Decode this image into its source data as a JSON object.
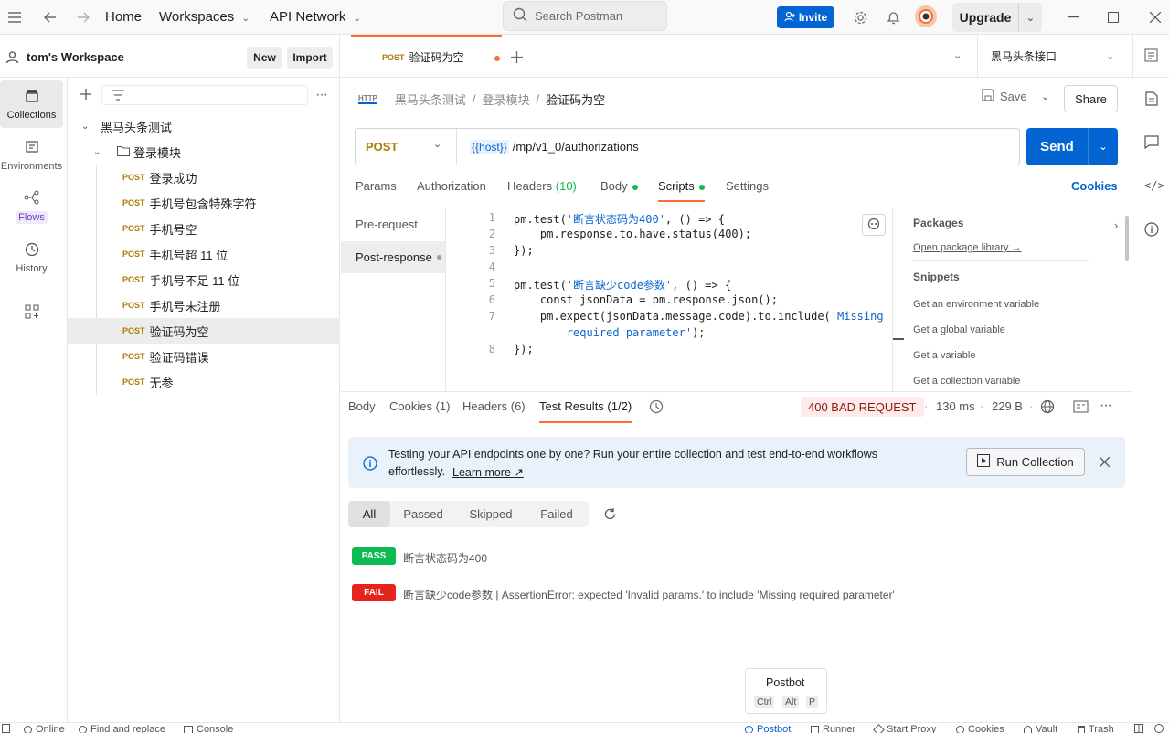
{
  "topbar": {
    "home": "Home",
    "workspaces": "Workspaces",
    "api_network": "API Network",
    "search_placeholder": "Search Postman",
    "invite": "Invite",
    "upgrade": "Upgrade"
  },
  "workspace": {
    "name": "tom's Workspace",
    "new": "New",
    "import": "Import"
  },
  "rail": [
    {
      "label": "Collections",
      "icon": "collections-icon"
    },
    {
      "label": "Environments",
      "icon": "environments-icon"
    },
    {
      "label": "Flows",
      "icon": "flows-icon"
    },
    {
      "label": "History",
      "icon": "history-icon"
    }
  ],
  "tree": {
    "collection": "黑马头条测试",
    "folder": "登录模块",
    "method": "POST",
    "requests": [
      "登录成功",
      "手机号包含特殊字符",
      "手机号空",
      "手机号超 11 位",
      "手机号不足 11 位",
      "手机号未注册",
      "验证码为空",
      "验证码错误",
      "无参"
    ]
  },
  "tab": {
    "method": "POST",
    "title": "验证码为空",
    "environment": "黑马头条接口"
  },
  "breadcrumb": {
    "collection": "黑马头条测试",
    "sep1": "/",
    "folder": "登录模块",
    "sep2": "/",
    "request": "验证码为空",
    "save": "Save",
    "share": "Share"
  },
  "request": {
    "method": "POST",
    "url_var": "{{host}}",
    "url_path": "/mp/v1_0/authorizations",
    "send": "Send",
    "tabs": {
      "params": "Params",
      "authorization": "Authorization",
      "headers": "Headers",
      "headers_count": "(10)",
      "body": "Body",
      "scripts": "Scripts",
      "settings": "Settings",
      "cookies": "Cookies"
    },
    "script_tabs": [
      "Pre-request",
      "Post-response"
    ]
  },
  "code_lines": [
    {
      "n": "1",
      "pre": "pm.test(",
      "str": "'断言状态码为400'",
      "post": ", () => {"
    },
    {
      "n": "2",
      "pre": "    pm.response.to.have.status(400);",
      "str": "",
      "post": ""
    },
    {
      "n": "3",
      "pre": "});",
      "str": "",
      "post": ""
    },
    {
      "n": "4",
      "pre": "",
      "str": "",
      "post": ""
    },
    {
      "n": "5",
      "pre": "pm.test(",
      "str": "'断言缺少code参数'",
      "post": ", () => {"
    },
    {
      "n": "6",
      "pre": "    const jsonData = pm.response.json();",
      "str": "",
      "post": ""
    },
    {
      "n": "7",
      "pre": "    pm.expect(jsonData.message.code).to.include(",
      "str": "'Missing",
      "post": ""
    },
    {
      "n": "",
      "pre": "        ",
      "str": "required parameter'",
      "post": ");"
    },
    {
      "n": "8",
      "pre": "});",
      "str": "",
      "post": ""
    }
  ],
  "snippets": {
    "packages": "Packages",
    "open_library": "Open package library →",
    "snippets": "Snippets",
    "items": [
      "Get an environment variable",
      "Get a global variable",
      "Get a variable",
      "Get a collection variable"
    ]
  },
  "response": {
    "tabs": {
      "body": "Body",
      "cookies": "Cookies (1)",
      "headers": "Headers (6)",
      "tests": "Test Results (1/2)"
    },
    "status": "400 BAD REQUEST",
    "time": "130 ms",
    "size": "229 B",
    "banner_line1": "Testing your API endpoints one by one? Run your entire collection and test end-to-end workflows",
    "banner_line2": "effortlessly.",
    "learn_more": "Learn more ↗",
    "run_collection": "Run Collection",
    "filters": [
      "All",
      "Passed",
      "Skipped",
      "Failed"
    ],
    "results": [
      {
        "badge": "PASS",
        "color": "#0cbb52",
        "text": "断言状态码为400"
      },
      {
        "badge": "FAIL",
        "color": "#e5251c",
        "text": "断言缺少code参数 | AssertionError: expected 'Invalid params.' to include 'Missing required parameter'"
      }
    ]
  },
  "postbot_popup": {
    "title": "Postbot",
    "keys": [
      "Ctrl",
      "Alt",
      "P"
    ]
  },
  "statusbar": {
    "online": "Online",
    "find_replace": "Find and replace",
    "console": "Console",
    "postbot": "Postbot",
    "runner": "Runner",
    "start_proxy": "Start Proxy",
    "cookies": "Cookies",
    "vault": "Vault",
    "trash": "Trash"
  },
  "colors": {
    "accent": "#0265d2",
    "post_method": "#ad7a03",
    "orange_dot": "#ff6c37",
    "pass": "#0cbb52",
    "fail": "#e5251c"
  }
}
